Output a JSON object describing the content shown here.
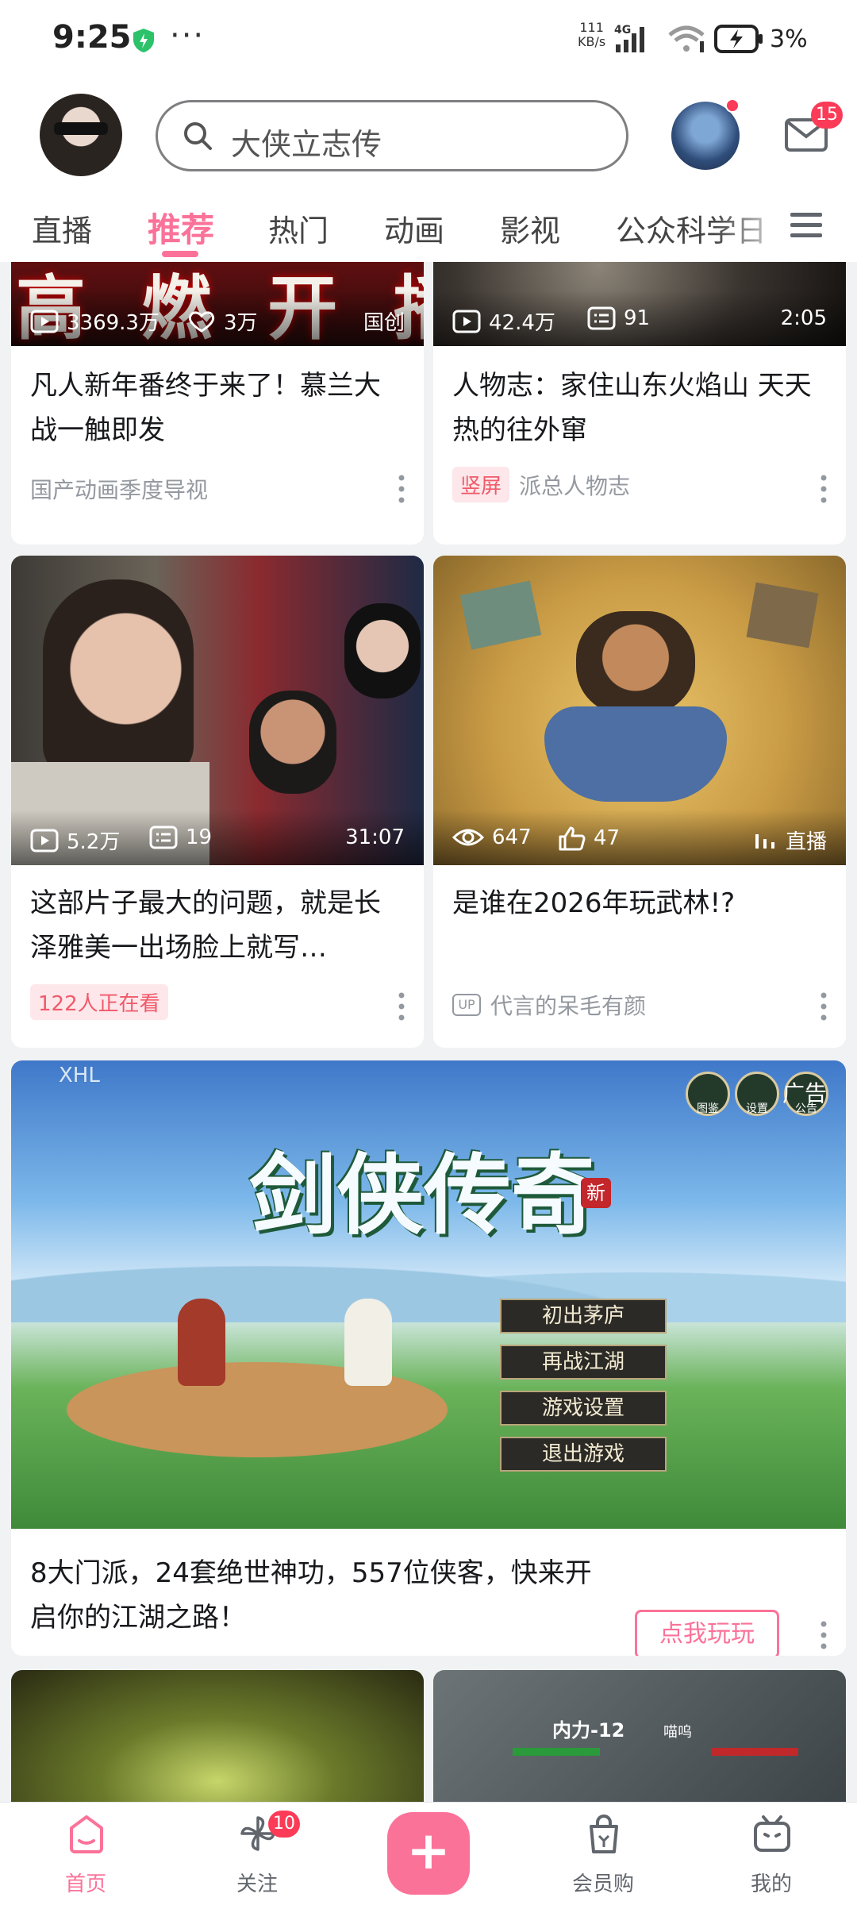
{
  "status_bar": {
    "time": "9:25",
    "net_speed_value": "111",
    "net_speed_unit": "KB/s",
    "network_type": "4G",
    "battery_percent": "3%",
    "more_icon": "more-dots-icon"
  },
  "header": {
    "search_placeholder": "大侠立志传",
    "mail_badge": "15"
  },
  "tabs": [
    {
      "label": "直播",
      "active": false
    },
    {
      "label": "推荐",
      "active": true
    },
    {
      "label": "热门",
      "active": false
    },
    {
      "label": "动画",
      "active": false
    },
    {
      "label": "影视",
      "active": false
    },
    {
      "label": "公众科学日",
      "active": false
    }
  ],
  "feed": {
    "cards": [
      {
        "thumb_text": "高 燃 开 播",
        "views": "3369.3万",
        "likes": "3万",
        "corner": "国创",
        "title": "凡人新年番终于来了！慕兰大战一触即发",
        "author": "国产动画季度导视"
      },
      {
        "views": "42.4万",
        "danmaku": "91",
        "duration": "2:05",
        "title": "人物志：家住山东火焰山 天天热的往外窜",
        "tag": "竖屏",
        "author": "派总人物志"
      },
      {
        "views": "5.2万",
        "danmaku": "19",
        "duration": "31:07",
        "title": "这部片子最大的问题，就是长泽雅美一出场脸上就写…",
        "tag": "122人正在看"
      },
      {
        "views": "647",
        "likes": "47",
        "corner": "直播",
        "title": "是谁在2026年玩武林!?",
        "author": "代言的呆毛有颜"
      }
    ],
    "ad": {
      "watermark": "XHL",
      "game_title": "剑侠传奇",
      "game_badge": "新",
      "menu": [
        "初出茅庐",
        "再战江湖",
        "游戏设置",
        "退出游戏"
      ],
      "top_icons": [
        "图鉴",
        "设置",
        "公告"
      ],
      "ad_label": "广告",
      "title": "8大门派，24套绝世神功，557位侠客，快来开启你的江湖之路！",
      "cta": "点我玩玩"
    },
    "bottom_thumbs": {
      "right_label": "内力-12",
      "right_label2": "喵呜"
    }
  },
  "bottom_nav": [
    {
      "label": "首页",
      "icon": "home-tv-icon",
      "active": true
    },
    {
      "label": "关注",
      "icon": "follow-pinwheel-icon",
      "badge": "10"
    },
    {
      "label": "",
      "icon": "plus-icon"
    },
    {
      "label": "会员购",
      "icon": "shopping-bag-icon"
    },
    {
      "label": "我的",
      "icon": "bilibili-tv-icon"
    }
  ],
  "colors": {
    "accent": "#fb7299",
    "badge": "#fb3b57",
    "text": "#18191c",
    "muted": "#9499a0"
  }
}
